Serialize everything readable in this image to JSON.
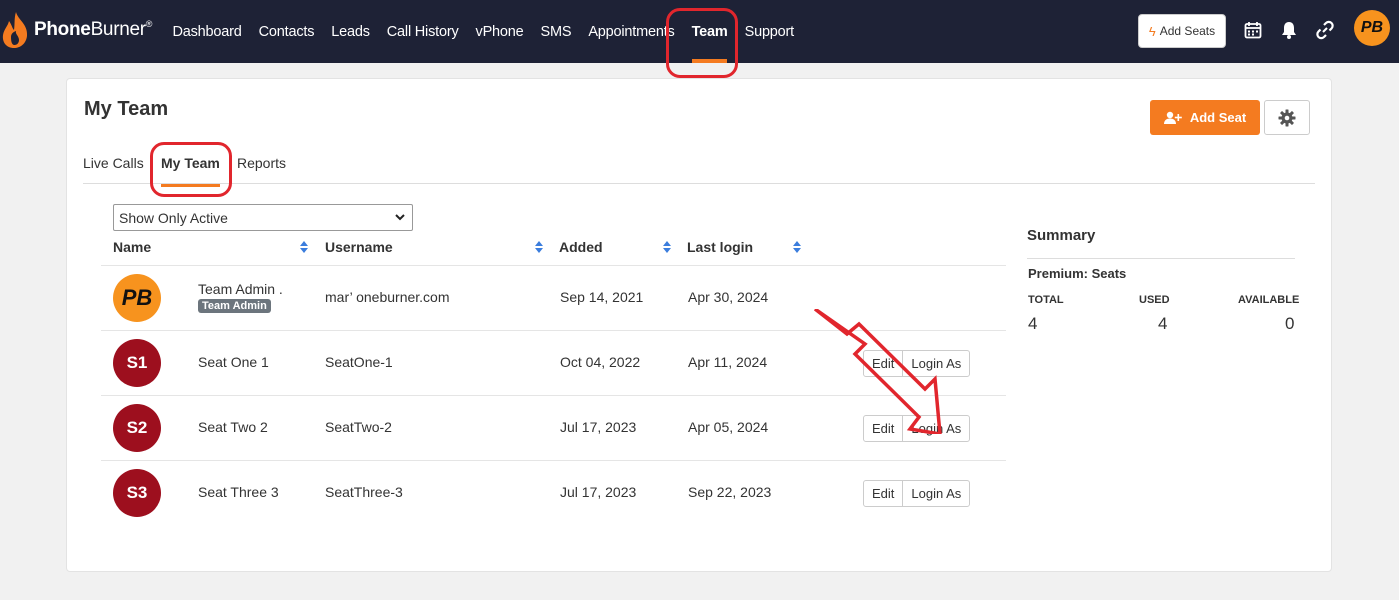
{
  "brand": {
    "name_bold": "Phone",
    "name_light": "Burner",
    "mark": "®"
  },
  "nav": [
    {
      "label": "Dashboard"
    },
    {
      "label": "Contacts"
    },
    {
      "label": "Leads"
    },
    {
      "label": "Call History"
    },
    {
      "label": "vPhone"
    },
    {
      "label": "SMS"
    },
    {
      "label": "Appointments"
    },
    {
      "label": "Team",
      "active": true
    },
    {
      "label": "Support"
    }
  ],
  "header_actions": {
    "add_seats_label": "Add Seats",
    "icons": [
      "calendar-icon",
      "bell-icon",
      "link-icon"
    ],
    "avatar_initials": "PB"
  },
  "page": {
    "title": "My Team",
    "add_seat_label": "Add Seat"
  },
  "tabs": [
    {
      "label": "Live Calls"
    },
    {
      "label": "My Team",
      "active": true
    },
    {
      "label": "Reports"
    }
  ],
  "filter": {
    "selected": "Show Only Active"
  },
  "table": {
    "columns": [
      "Name",
      "Username",
      "Added",
      "Last login"
    ],
    "rows": [
      {
        "avatar": "PB",
        "name": "Team Admin .",
        "badge": "Team Admin",
        "username": "mar’          oneburner.com",
        "added": "Sep 14, 2021",
        "last_login": "Apr 30, 2024",
        "actions": false
      },
      {
        "avatar": "S1",
        "name": "Seat One 1",
        "username": "SeatOne-1",
        "added": "Oct 04, 2022",
        "last_login": "Apr 11, 2024",
        "actions": true
      },
      {
        "avatar": "S2",
        "name": "Seat Two 2",
        "username": "SeatTwo-2",
        "added": "Jul 17, 2023",
        "last_login": "Apr 05, 2024",
        "actions": true
      },
      {
        "avatar": "S3",
        "name": "Seat Three 3",
        "username": "SeatThree-3",
        "added": "Jul 17, 2023",
        "last_login": "Sep 22, 2023",
        "actions": true
      }
    ],
    "edit_label": "Edit",
    "login_as_label": "Login As"
  },
  "summary": {
    "title": "Summary",
    "subtitle": "Premium: Seats",
    "total_label": "TOTAL",
    "used_label": "USED",
    "available_label": "AVAILABLE",
    "total": "4",
    "used": "4",
    "available": "0"
  },
  "colors": {
    "nav_bg": "#1e2236",
    "accent": "#f47b20",
    "avatar_red": "#9d0f1e",
    "annotation_red": "#e1262d"
  }
}
